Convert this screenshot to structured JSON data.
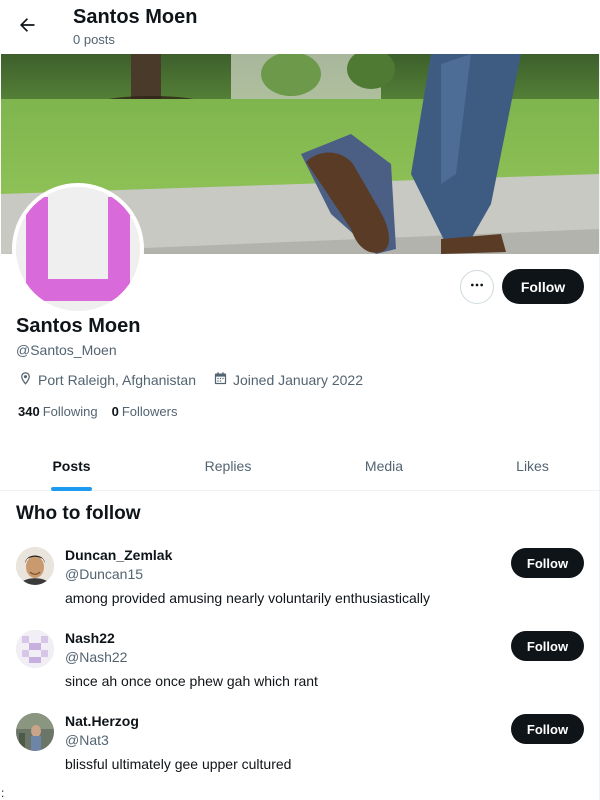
{
  "header": {
    "back_icon": "arrow-left-icon",
    "title": "Santos Moen",
    "subtitle": "0 posts"
  },
  "profile": {
    "name": "Santos Moen",
    "handle": "@Santos_Moen",
    "location": "Port Raleigh, Afghanistan",
    "joined": "Joined January 2022",
    "following_count": "340",
    "following_label": "Following",
    "followers_count": "0",
    "followers_label": "Followers",
    "more_icon": "more-horizontal-icon",
    "follow_label": "Follow",
    "avatar_color": "#d96ad9"
  },
  "tabs": [
    {
      "label": "Posts",
      "active": true
    },
    {
      "label": "Replies",
      "active": false
    },
    {
      "label": "Media",
      "active": false
    },
    {
      "label": "Likes",
      "active": false
    }
  ],
  "who_to_follow": {
    "title": "Who to follow",
    "suggestions": [
      {
        "name": "Duncan_Zemlak",
        "handle": "@Duncan15",
        "bio": "among provided amusing nearly voluntarily enthusiastically",
        "follow_label": "Follow"
      },
      {
        "name": "Nash22",
        "handle": "@Nash22",
        "bio": "since ah once once phew gah which rant",
        "follow_label": "Follow"
      },
      {
        "name": "Nat.Herzog",
        "handle": "@Nat3",
        "bio": "blissful ultimately gee upper cultured",
        "follow_label": "Follow"
      }
    ]
  },
  "stray_text": ":",
  "colors": {
    "accent": "#1d9bf0",
    "button_dark": "#0f1419",
    "muted_text": "#536471"
  }
}
